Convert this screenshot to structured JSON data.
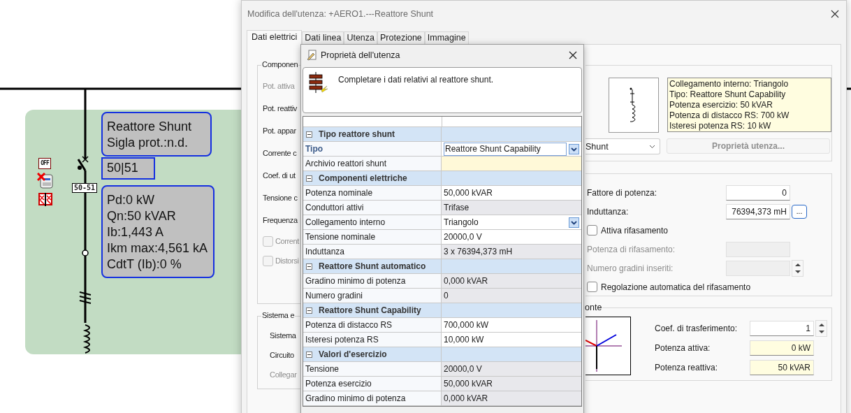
{
  "diagram": {
    "status_badge": "OFF",
    "protection_tag": "50-51",
    "labels": [
      {
        "kind": "rounded",
        "lines": [
          "Reattore Shunt",
          "Sigla prot.:n.d."
        ]
      },
      {
        "kind": "square",
        "lines": [
          "50|51"
        ]
      },
      {
        "kind": "rounded",
        "lines": [
          "Pd:0 kW",
          "Qn:50 kVAR",
          "Ib:1,443 A",
          "Ikm max:4,561 kA",
          "CdtT (Ib):0 %"
        ]
      }
    ]
  },
  "window": {
    "title": "Modifica dell'utenza: +AERO1.---Reattore Shunt"
  },
  "tabs": [
    {
      "label": "Dati elettrici",
      "selected": true
    },
    {
      "label": "Dati linea",
      "selected": false
    },
    {
      "label": "Utenza",
      "selected": false
    },
    {
      "label": "Protezione",
      "selected": false
    },
    {
      "label": "Immagine",
      "selected": false
    }
  ],
  "left_groups": [
    {
      "title": "Componen",
      "rows": [
        {
          "kind": "label",
          "text": "Pot. attiva",
          "disabled": true
        },
        {
          "kind": "label",
          "text": "Pot. reattiv",
          "disabled": false
        },
        {
          "kind": "label",
          "text": "Pot. appar",
          "disabled": false
        },
        {
          "kind": "label",
          "text": "Corrente c",
          "disabled": false
        },
        {
          "kind": "label",
          "text": "Coef. di ut",
          "disabled": false
        },
        {
          "kind": "label",
          "text": "Tensione c",
          "disabled": false
        },
        {
          "kind": "label",
          "text": "Frequenza",
          "disabled": false
        },
        {
          "kind": "checkbox",
          "text": "Corrent",
          "checked": false,
          "disabled": true
        },
        {
          "kind": "checkbox",
          "text": "Distorsi",
          "checked": false,
          "disabled": true
        }
      ]
    },
    {
      "title": "Sistema e",
      "rows": [
        {
          "kind": "label",
          "text": "Sistema",
          "disabled": false
        },
        {
          "kind": "label",
          "text": "Circuito",
          "disabled": false
        },
        {
          "kind": "label",
          "text": "Collegar",
          "disabled": true
        }
      ]
    }
  ],
  "preview": {
    "info": [
      "Collegamento interno: Triangolo",
      "Tipo: Reattore Shunt Capability",
      "Potenza esercizio: 50 kVAR",
      "Potenza di distacco RS: 700 kW",
      "Isteresi potenza RS: 10 kW"
    ]
  },
  "type_select": {
    "value": "Shunt"
  },
  "properties_button": {
    "label": "Proprietà utenza...",
    "disabled": true
  },
  "settings": [
    {
      "kind": "field",
      "label": "Fattore di potenza:",
      "value": "0",
      "disabled": false
    },
    {
      "kind": "field-button",
      "label": "Induttanza:",
      "value": "76394,373 mH",
      "button": "...",
      "disabled": false
    },
    {
      "kind": "checkbox",
      "label": "Attiva rifasamento",
      "checked": false,
      "disabled": false
    },
    {
      "kind": "field",
      "label": "Potenza di rifasamento:",
      "disabled": true
    },
    {
      "kind": "spin",
      "label": "Numero gradini inseriti:",
      "disabled": true
    },
    {
      "kind": "checkbox",
      "label": "Regolazione automatica del rifasamento",
      "checked": false,
      "disabled": false
    }
  ],
  "source_group": {
    "title": "onte",
    "rows": [
      {
        "kind": "spin",
        "label": "Coef. di trasferimento:",
        "value": "1",
        "readonly": false
      },
      {
        "kind": "field",
        "label": "Potenza attiva:",
        "value": "0 kW",
        "readonly": true
      },
      {
        "kind": "field",
        "label": "Potenza reattiva:",
        "value": "50 kVAR",
        "readonly": true
      }
    ]
  },
  "popup": {
    "title": "Proprietà dell'utenza",
    "message": "Completare i dati relativi al reattore shunt.",
    "sections": [
      {
        "title": "Tipo reattore shunt",
        "expanded": true,
        "rows": [
          {
            "name": "Tipo",
            "value": "Reattore Shunt Capability",
            "kind": "dropdown",
            "readonly": false,
            "selected": true
          },
          {
            "name": "Archivio reattori shunt",
            "kind": "lookup",
            "readonly": false,
            "selected": false
          }
        ]
      },
      {
        "title": "Componenti elettriche",
        "expanded": true,
        "rows": [
          {
            "name": "Potenza nominale",
            "value": "50,000 kVAR",
            "kind": "text",
            "readonly": false,
            "selected": false
          },
          {
            "name": "Conduttori attivi",
            "value": "Trifase",
            "kind": "text",
            "readonly": true,
            "selected": false
          },
          {
            "name": "Collegamento interno",
            "value": "Triangolo",
            "kind": "dropdown",
            "readonly": false,
            "selected": false
          },
          {
            "name": "Tensione nominale",
            "value": "20000,0 V",
            "kind": "text",
            "readonly": false,
            "selected": false
          },
          {
            "name": "Induttanza",
            "value": "3 x 76394,373 mH",
            "kind": "text",
            "readonly": true,
            "selected": false
          }
        ]
      },
      {
        "title": "Reattore Shunt automatico",
        "expanded": true,
        "rows": [
          {
            "name": "Gradino minimo di potenza",
            "value": "0,000 kVAR",
            "kind": "text",
            "readonly": true,
            "selected": false
          },
          {
            "name": "Numero gradini",
            "value": "0",
            "kind": "text",
            "readonly": true,
            "selected": false
          }
        ]
      },
      {
        "title": "Reattore Shunt Capability",
        "expanded": true,
        "rows": [
          {
            "name": "Potenza di distacco RS",
            "value": "700,000 kW",
            "kind": "text",
            "readonly": false,
            "selected": false
          },
          {
            "name": "Isteresi potenza RS",
            "value": "10,000 kW",
            "kind": "text",
            "readonly": false,
            "selected": false
          }
        ]
      },
      {
        "title": "Valori d'esercizio",
        "expanded": true,
        "rows": [
          {
            "name": "Tensione",
            "value": "20000,0 V",
            "kind": "text",
            "readonly": true,
            "selected": false
          },
          {
            "name": "Potenza esercizio",
            "value": "50,000 kVAR",
            "kind": "text",
            "readonly": true,
            "selected": false
          },
          {
            "name": "Gradino minimo di potenza",
            "value": "0,000 kVAR",
            "kind": "text",
            "readonly": true,
            "selected": false
          }
        ]
      }
    ]
  }
}
